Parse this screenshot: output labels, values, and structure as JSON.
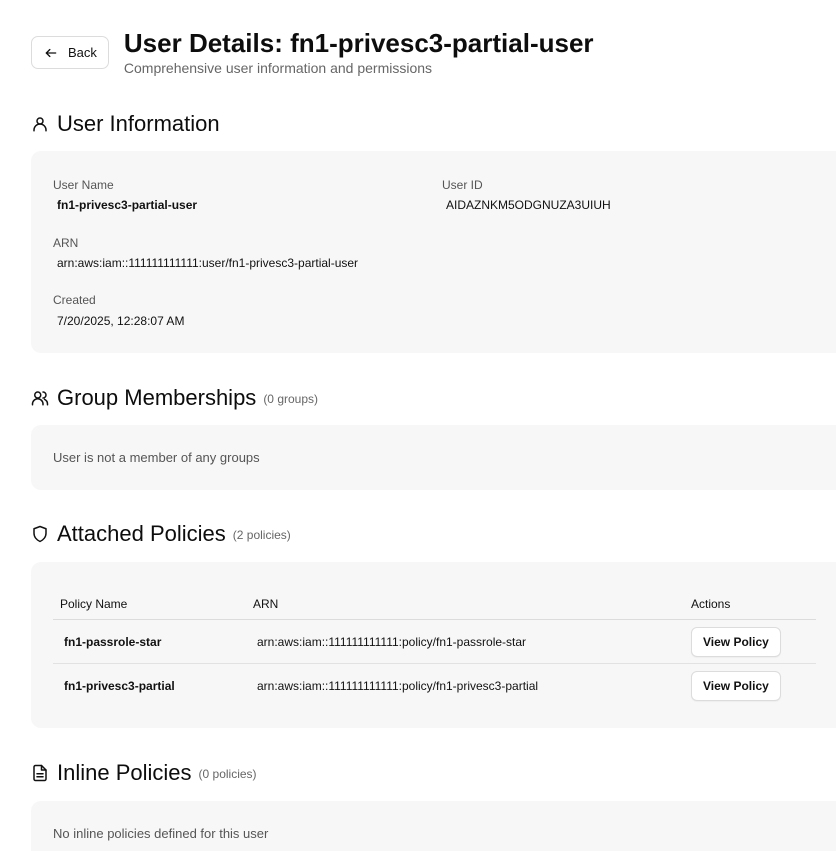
{
  "header": {
    "back_label": "Back",
    "title": "User Details: fn1-privesc3-partial-user",
    "subtitle": "Comprehensive user information and permissions"
  },
  "user_info": {
    "title": "User Information",
    "icon": "user-icon",
    "user_name_label": "User Name",
    "user_name": "fn1-privesc3-partial-user",
    "user_id_label": "User ID",
    "user_id": "AIDAZNKM5ODGNUZA3UIUH",
    "arn_label": "ARN",
    "arn": "arn:aws:iam::111111111111:user/fn1-privesc3-partial-user",
    "created_label": "Created",
    "created": "7/20/2025, 12:28:07 AM"
  },
  "groups": {
    "title": "Group Memberships",
    "icon": "users-icon",
    "count": "(0 groups)",
    "empty": "User is not a member of any groups"
  },
  "attached": {
    "title": "Attached Policies",
    "icon": "shield-icon",
    "count": "(2 policies)",
    "columns": [
      "Policy Name",
      "ARN",
      "Actions"
    ],
    "rows": [
      {
        "name": "fn1-passrole-star",
        "arn": "arn:aws:iam::111111111111:policy/fn1-passrole-star",
        "action": "View Policy"
      },
      {
        "name": "fn1-privesc3-partial",
        "arn": "arn:aws:iam::111111111111:policy/fn1-privesc3-partial",
        "action": "View Policy"
      }
    ]
  },
  "inline": {
    "title": "Inline Policies",
    "icon": "document-icon",
    "count": "(0 policies)",
    "empty": "No inline policies defined for this user"
  }
}
